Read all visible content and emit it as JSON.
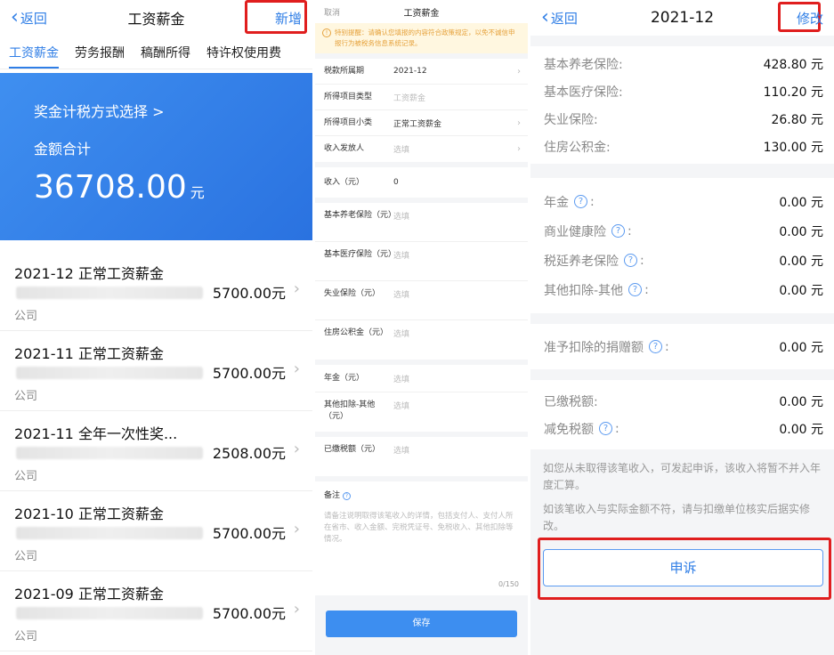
{
  "panel1": {
    "back_label": "返回",
    "title": "工资薪金",
    "add_label": "新增",
    "tabs": [
      "工资薪金",
      "劳务报酬",
      "稿酬所得",
      "特许权使用费"
    ],
    "summary": {
      "method_label": "奖金计税方式选择 >",
      "total_label": "金额合计",
      "total_amount": "36708.00",
      "unit": "元"
    },
    "records": [
      {
        "title": "2021-12 正常工资薪金",
        "amount": "5700.00元",
        "company": "公司"
      },
      {
        "title": "2021-11 正常工资薪金",
        "amount": "5700.00元",
        "company": "公司"
      },
      {
        "title": "2021-11 全年一次性奖...",
        "amount": "2508.00元",
        "company": "公司"
      },
      {
        "title": "2021-10 正常工资薪金",
        "amount": "5700.00元",
        "company": "公司"
      },
      {
        "title": "2021-09 正常工资薪金",
        "amount": "5700.00元",
        "company": "公司"
      }
    ]
  },
  "panel2": {
    "cancel_label": "取消",
    "title": "工资薪金",
    "notice": "特别提醒：请确认您填报的内容符合政策规定，以免不诚信申报行为被税务信息系统记录。",
    "group1": [
      {
        "label": "税款所属期",
        "value": "2021-12"
      },
      {
        "label": "所得项目类型",
        "value": "工资薪金"
      },
      {
        "label": "所得项目小类",
        "value": "正常工资薪金"
      },
      {
        "label": "收入发放人",
        "value": "选填"
      }
    ],
    "income": {
      "label": "收入（元）",
      "value": "0"
    },
    "group2": [
      {
        "label": "基本养老保险（元）",
        "value": "选填"
      },
      {
        "label": "基本医疗保险（元）",
        "value": "选填"
      },
      {
        "label": "失业保险（元）",
        "value": "选填"
      },
      {
        "label": "住房公积金（元）",
        "value": "选填"
      }
    ],
    "group3": [
      {
        "label": "年金（元）",
        "value": "选填"
      },
      {
        "label": "其他扣除-其他（元）",
        "value": "选填"
      }
    ],
    "paid_tax": {
      "label": "已缴税额（元）",
      "value": "选填"
    },
    "notes": {
      "label": "备注",
      "placeholder": "请备注说明取得该笔收入的详情，包括支付人、支付人所在省市、收入金额、完税凭证号、免税收入、其他扣除等情况。",
      "counter": "0/150"
    },
    "save_label": "保存"
  },
  "panel3": {
    "back_label": "返回",
    "title": "2021-12",
    "edit_label": "修改",
    "section1": [
      {
        "label": "基本养老保险:",
        "value": "428.80 元"
      },
      {
        "label": "基本医疗保险:",
        "value": "110.20 元"
      },
      {
        "label": "失业保险:",
        "value": "26.80 元"
      },
      {
        "label": "住房公积金:",
        "value": "130.00 元"
      }
    ],
    "section2": [
      {
        "label": "年金",
        "value": "0.00 元"
      },
      {
        "label": "商业健康险",
        "value": "0.00 元"
      },
      {
        "label": "税延养老保险",
        "value": "0.00 元"
      },
      {
        "label": "其他扣除-其他",
        "value": "0.00 元"
      }
    ],
    "section3": [
      {
        "label": "准予扣除的捐赠额",
        "value": "0.00 元"
      }
    ],
    "section4": [
      {
        "label": "已缴税额:",
        "value": "0.00 元"
      },
      {
        "label": "减免税额",
        "value": "0.00 元"
      }
    ],
    "note1": "如您从未取得该笔收入，可发起申诉，该收入将暂不并入年度汇算。",
    "note2": "如该笔收入与实际金额不符，请与扣缴单位核实后据实修改。",
    "appeal_label": "申诉"
  }
}
